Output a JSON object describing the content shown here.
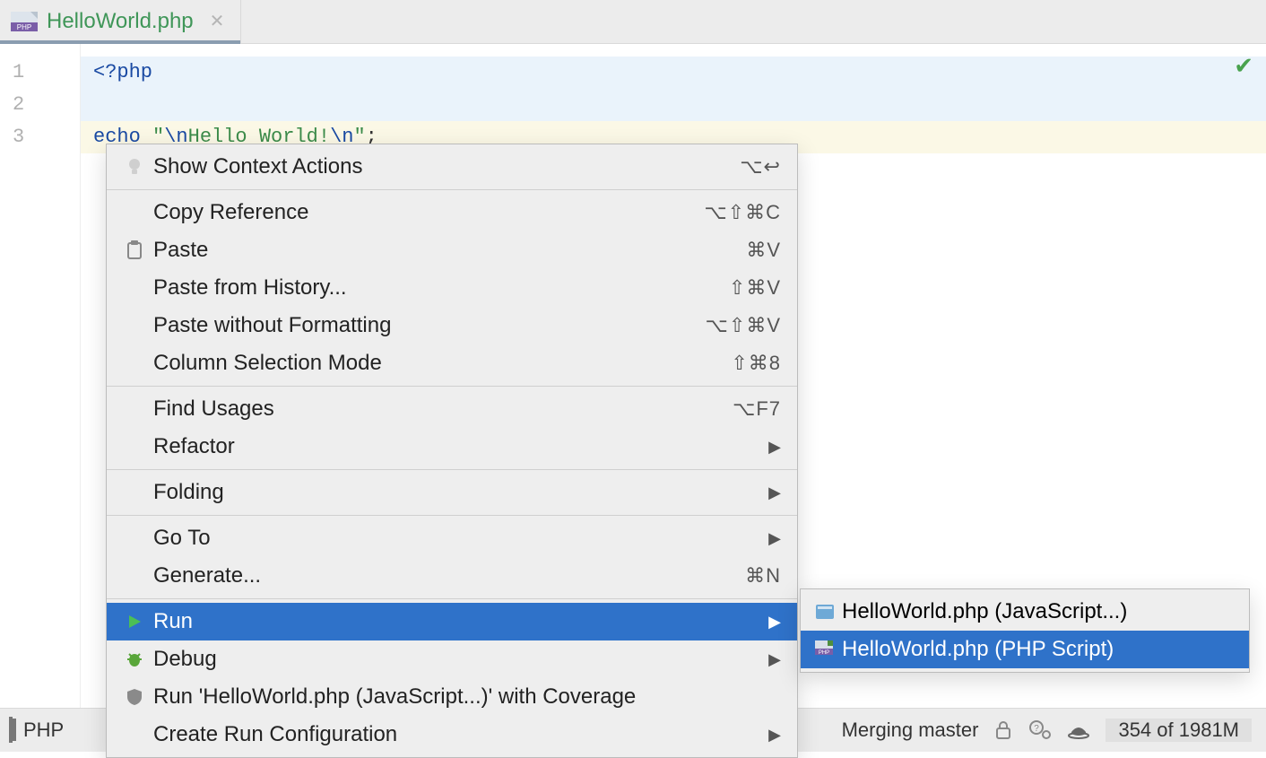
{
  "tab": {
    "filename": "HelloWorld.php",
    "icon": "php-file-icon"
  },
  "gutter": {
    "lines": [
      "1",
      "2",
      "3"
    ]
  },
  "code": {
    "l1": {
      "open": "<?php"
    },
    "l3": {
      "kw": "echo",
      "q": "\"",
      "esc": "\\n",
      "txt": "Hello World!",
      "semi": ";"
    }
  },
  "context_menu": {
    "show_ctx": {
      "label": "Show Context Actions",
      "shortcut": "⌥↩"
    },
    "copy_ref": {
      "label": "Copy Reference",
      "shortcut": "⌥⇧⌘C"
    },
    "paste": {
      "label": "Paste",
      "shortcut": "⌘V"
    },
    "paste_hist": {
      "label": "Paste from History...",
      "shortcut": "⇧⌘V"
    },
    "paste_fmt": {
      "label": "Paste without Formatting",
      "shortcut": "⌥⇧⌘V"
    },
    "col_sel": {
      "label": "Column Selection Mode",
      "shortcut": "⇧⌘8"
    },
    "find_usages": {
      "label": "Find Usages",
      "shortcut": "⌥F7"
    },
    "refactor": {
      "label": "Refactor"
    },
    "folding": {
      "label": "Folding"
    },
    "goto": {
      "label": "Go To"
    },
    "generate": {
      "label": "Generate...",
      "shortcut": "⌘N"
    },
    "run": {
      "label": "Run"
    },
    "debug": {
      "label": "Debug"
    },
    "run_cov": {
      "label": "Run 'HelloWorld.php (JavaScript...)' with Coverage"
    },
    "create_rc": {
      "label": "Create Run Configuration"
    }
  },
  "submenu": {
    "js": {
      "label": "HelloWorld.php (JavaScript...)"
    },
    "php": {
      "label": "HelloWorld.php (PHP Script)"
    }
  },
  "statusbar": {
    "left_text": "PHP",
    "merge_text": "Merging master",
    "memory": "354 of 1981M"
  }
}
